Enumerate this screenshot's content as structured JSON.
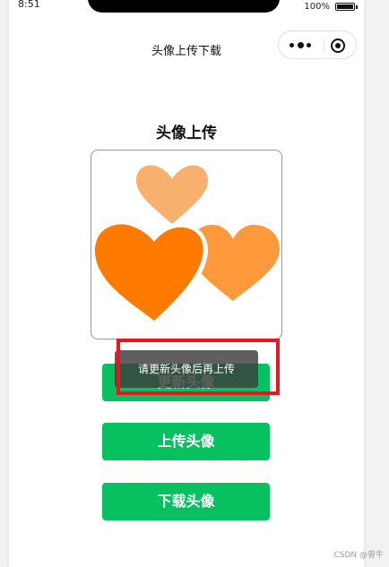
{
  "status_bar": {
    "time": "8:51",
    "battery_percent": "100%"
  },
  "nav": {
    "title": "头像上传下载"
  },
  "main": {
    "section_title": "头像上传",
    "buttons": {
      "change": "更新头像",
      "upload": "上传头像",
      "download": "下载头像"
    }
  },
  "toast": {
    "message": "请更新头像后再上传"
  },
  "watermark": "CSDN @曾牛",
  "colors": {
    "primary_button": "#07c160",
    "heart_dark": "#ff7a00",
    "heart_mid": "#ff9a3c",
    "heart_light": "#f7b06e",
    "highlight": "#e8161f"
  },
  "icons": {
    "capsule_more": "more-dots-icon",
    "capsule_close": "target-close-icon",
    "avatar_image": "hearts-image"
  }
}
